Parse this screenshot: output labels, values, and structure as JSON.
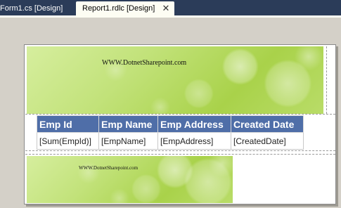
{
  "tabs": [
    {
      "label": "Form1.cs [Design]",
      "active": false
    },
    {
      "label": "Report1.rdlc [Design]",
      "active": true
    }
  ],
  "close_icon": "close-icon",
  "report": {
    "header_banner": "WWW.DotnetSharepoint.com",
    "footer_banner": "WWW.DotnetSharepoint.com",
    "columns": [
      "Emp Id",
      "Emp Name",
      "Emp Address",
      "Created Date"
    ],
    "row": [
      "[Sum(EmpId)]",
      "[EmpName]",
      "[EmpAddress]",
      "[CreatedDate]"
    ]
  },
  "colors": {
    "tab_strip": "#2b3c59",
    "header_fill": "#4f6ea8",
    "workspace": "#d4d0c8",
    "banner_green": "#c2e27a"
  }
}
